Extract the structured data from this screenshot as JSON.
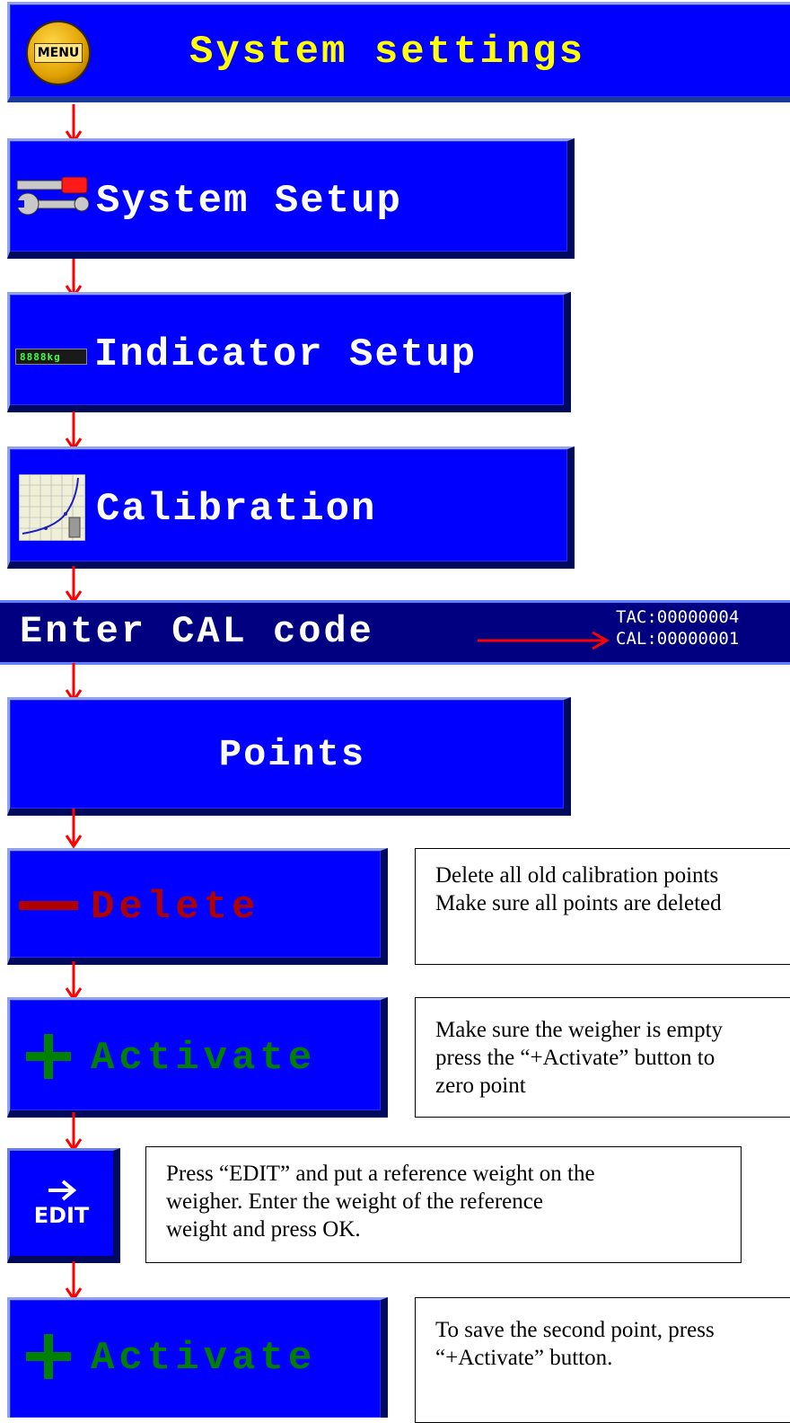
{
  "header": {
    "title": "System settings",
    "menu_icon_text": "MENU",
    "colors": {
      "bg": "#0000ff",
      "text": "#ffff00"
    }
  },
  "flow": {
    "system_setup": "System Setup",
    "indicator_setup": "Indicator Setup",
    "indicator_icon_text": "8888kg",
    "calibration": "Calibration",
    "cal_code": {
      "label": "Enter CAL code",
      "tac": "TAC:00000004",
      "cal": "CAL:00000001"
    },
    "points": "Points",
    "delete": "Delete",
    "activate_1": "Activate",
    "edit_label": "EDIT",
    "activate_2": "Activate"
  },
  "notes": {
    "delete_line1": "Delete all old calibration points",
    "delete_line2": "Make sure all points are deleted",
    "activate_line1": "Make sure the weigher is empty",
    "activate_line2": "press the “+Activate” button to",
    "activate_line3": "zero point",
    "edit_line1": "Press “EDIT” and put a reference weight on the",
    "edit_line2": "weigher. Enter the weight of the reference",
    "edit_line3": "weight and press OK.",
    "save_line1": "To save the second point, press",
    "save_line2": "“+Activate” button."
  },
  "colors": {
    "button_blue": "#0000ff",
    "arrow_red": "#ff0000",
    "delete_red": "#b00000",
    "activate_green": "#008000"
  }
}
